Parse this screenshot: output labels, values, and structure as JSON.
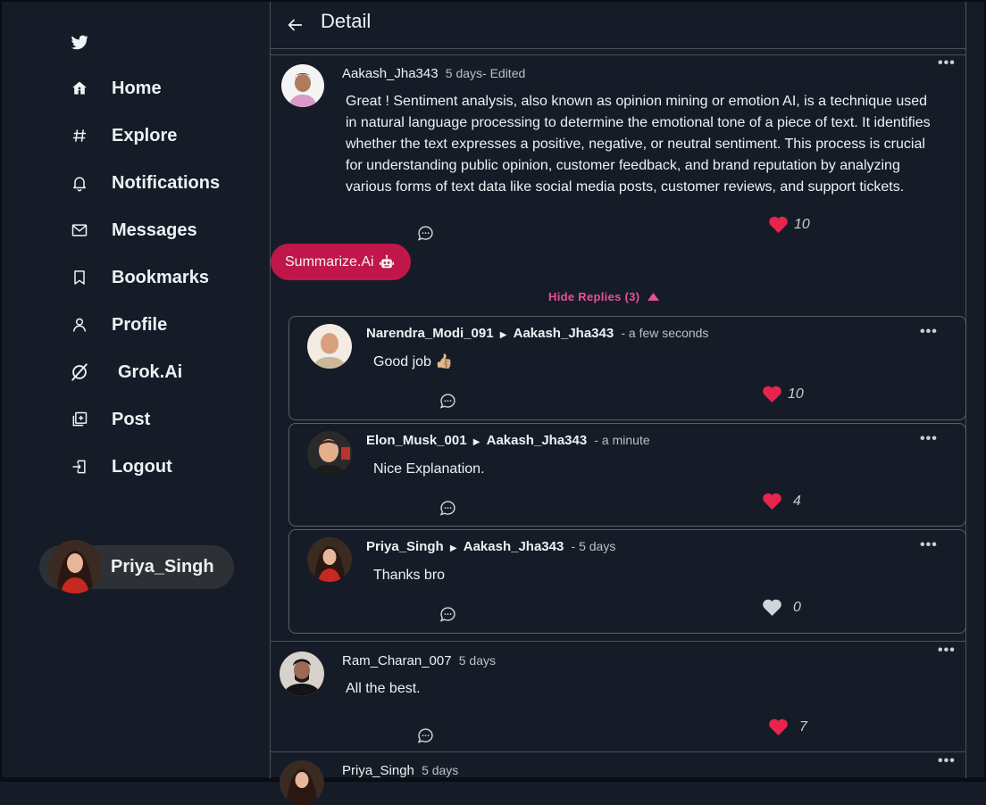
{
  "sidebar": {
    "logo_icon": "twitter-bird-icon",
    "items": [
      {
        "label": "Home",
        "icon": "home-icon"
      },
      {
        "label": "Explore",
        "icon": "hash-icon"
      },
      {
        "label": "Notifications",
        "icon": "bell-icon"
      },
      {
        "label": "Messages",
        "icon": "mail-icon"
      },
      {
        "label": "Bookmarks",
        "icon": "bookmark-icon"
      },
      {
        "label": "Profile",
        "icon": "user-icon"
      },
      {
        "label": "Grok.Ai",
        "icon": "grok-icon"
      },
      {
        "label": "Post",
        "icon": "add-post-icon"
      },
      {
        "label": "Logout",
        "icon": "logout-icon"
      }
    ],
    "user": {
      "name": "Priya_Singh"
    }
  },
  "header": {
    "title": "Detail"
  },
  "post": {
    "author": "Aakash_Jha343",
    "meta": "5 days- Edited",
    "text": "Great ! Sentiment analysis, also known as opinion mining or emotion AI, is a technique used in natural language processing to determine the emotional tone of a piece of text. It identifies whether the text expresses a positive, negative, or neutral sentiment. This process is crucial for understanding public opinion, customer feedback, and brand reputation by analyzing various forms of text data like social media posts, customer reviews, and support tickets.",
    "likes": "10",
    "more": "•••"
  },
  "summarize_button": {
    "label": "Summarize.Ai"
  },
  "replies_toggle": {
    "label": "Hide Replies (3)"
  },
  "replies": [
    {
      "author": "Narendra_Modi_091",
      "target": "Aakash_Jha343",
      "time": "- a few seconds",
      "text": "Good job 👍🏼",
      "likes": "10",
      "liked": true
    },
    {
      "author": "Elon_Musk_001",
      "target": "Aakash_Jha343",
      "time": "- a minute",
      "text": "Nice Explanation.",
      "likes": "4",
      "liked": true
    },
    {
      "author": "Priya_Singh",
      "target": "Aakash_Jha343",
      "time": "- 5 days",
      "text": "Thanks bro",
      "likes": "0",
      "liked": false
    }
  ],
  "comments": [
    {
      "author": "Ram_Charan_007",
      "time": "5 days",
      "text": "All the best.",
      "likes": "7"
    },
    {
      "author": "Priya_Singh",
      "time": "5 days"
    }
  ],
  "colors": {
    "background": "#151c27",
    "accent": "#c0174a",
    "heart": "#e8244d",
    "replies_link": "#e6519c",
    "border": "#4c525a"
  }
}
